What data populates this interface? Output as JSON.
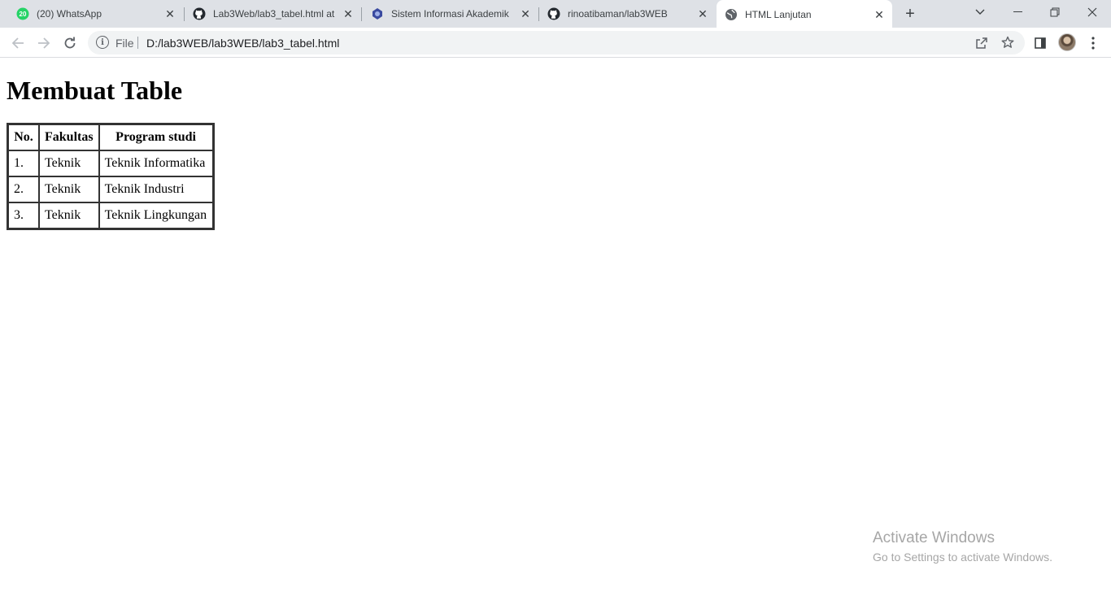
{
  "browser": {
    "tabs": [
      {
        "title": "(20) WhatsApp",
        "favicon": "whatsapp-icon",
        "badge": "20",
        "active": false
      },
      {
        "title": "Lab3Web/lab3_tabel.html at",
        "favicon": "github-icon",
        "active": false
      },
      {
        "title": "Sistem Informasi Akademik",
        "favicon": "university-logo-icon",
        "active": false
      },
      {
        "title": "rinoatibaman/lab3WEB",
        "favicon": "github-icon",
        "active": false
      },
      {
        "title": "HTML Lanjutan",
        "favicon": "globe-icon",
        "active": true
      }
    ],
    "close_glyph": "✕",
    "new_tab_glyph": "+",
    "address": {
      "scheme_label": "File",
      "url": "D:/lab3WEB/lab3WEB/lab3_tabel.html",
      "info_glyph": "i"
    }
  },
  "page": {
    "heading": "Membuat Table",
    "table": {
      "headers": [
        "No.",
        "Fakultas",
        "Program studi"
      ],
      "rows": [
        [
          "1.",
          "Teknik",
          "Teknik Informatika"
        ],
        [
          "2.",
          "Teknik",
          "Teknik Industri"
        ],
        [
          "3.",
          "Teknik",
          "Teknik Lingkungan"
        ]
      ]
    }
  },
  "watermark": {
    "title": "Activate Windows",
    "subtitle": "Go to Settings to activate Windows."
  },
  "colors": {
    "tabstrip_bg": "#dee1e6",
    "omnibox_bg": "#f1f3f4",
    "whatsapp_green": "#25d366",
    "watermark_text": "#a6a6a6"
  }
}
